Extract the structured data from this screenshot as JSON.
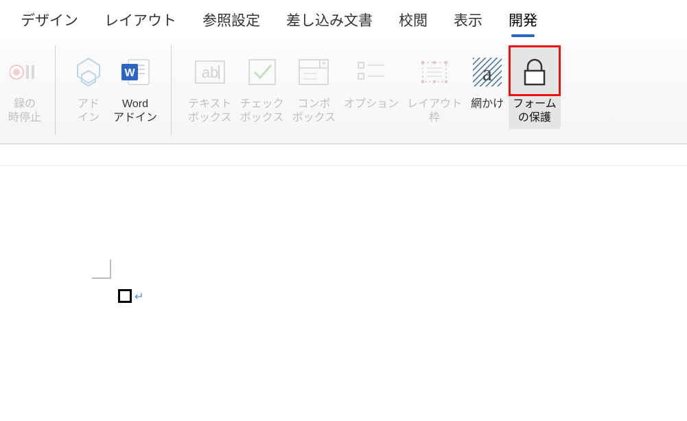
{
  "tabs": {
    "design": "デザイン",
    "layout": "レイアウト",
    "references": "参照設定",
    "mailings": "差し込み文書",
    "review": "校閲",
    "view": "表示",
    "developer": "開発"
  },
  "ribbon": {
    "record_stop": "録の\n時停止",
    "addins": "アド\nイン",
    "word_addins": "Word\nアドイン",
    "textbox": "テキスト\nボックス",
    "checkbox": "チェック\nボックス",
    "combobox": "コンボ\nボックス",
    "options": "オプション",
    "layout_frame": "レイアウト\n枠",
    "shading": "網かけ",
    "form_protect": "フォーム\nの保護"
  },
  "para_mark": "↵"
}
